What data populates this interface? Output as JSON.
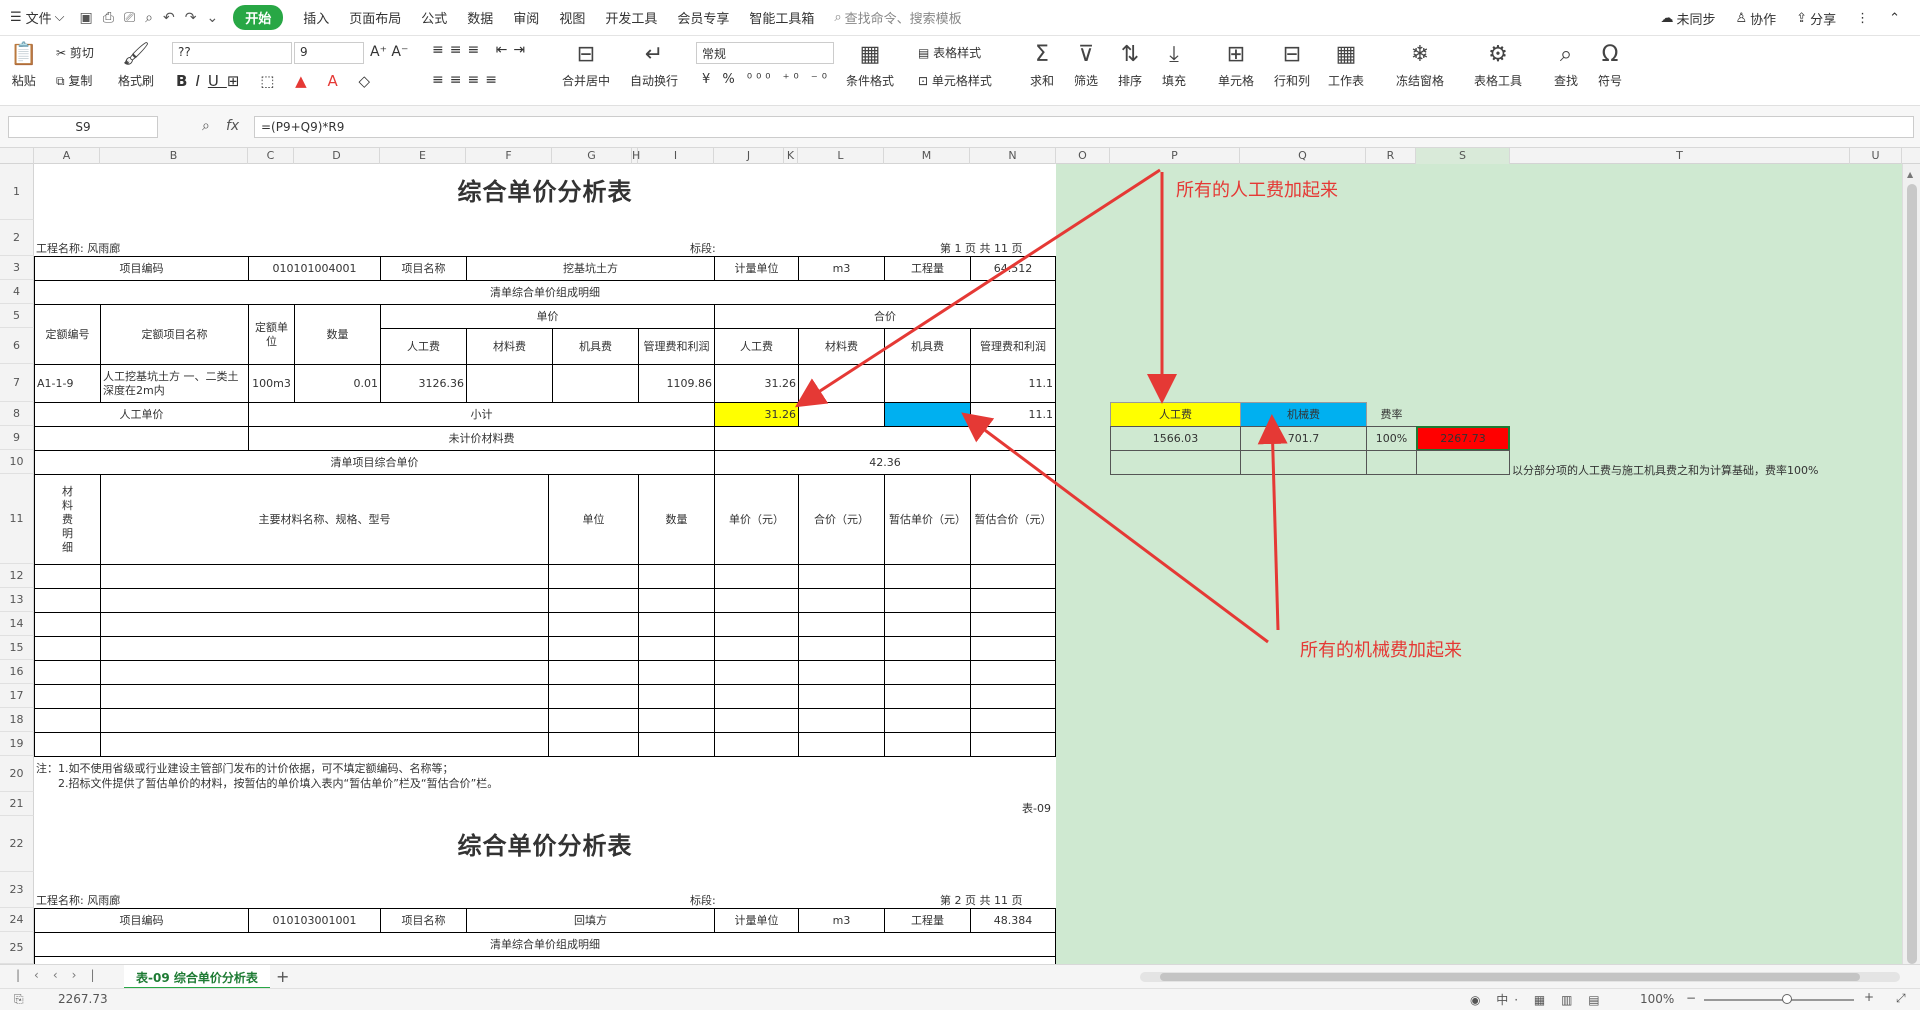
{
  "menu": {
    "file": "文件",
    "tabs": [
      "开始",
      "插入",
      "页面布局",
      "公式",
      "数据",
      "审阅",
      "视图",
      "开发工具",
      "会员专享",
      "智能工具箱"
    ],
    "search": "查找命令、搜索模板",
    "sync": "未同步",
    "collab": "协作",
    "share": "分享"
  },
  "ribbon": {
    "paste": "粘贴",
    "cut": "剪切",
    "copy": "复制",
    "format_painter": "格式刷",
    "font_name": "??",
    "font_size": "9",
    "number_format": "常规",
    "merge": "合并居中",
    "wrap": "自动换行",
    "cond_format": "条件格式",
    "table_style": "表格样式",
    "cell_style": "单元格样式",
    "sum": "求和",
    "filter": "筛选",
    "sort": "排序",
    "fill": "填充",
    "cell": "单元格",
    "rowcol": "行和列",
    "sheet": "工作表",
    "freeze": "冻结窗格",
    "table_tools": "表格工具",
    "find": "查找",
    "symbol": "符号"
  },
  "formula_bar": {
    "name_box": "S9",
    "fx": "fx",
    "formula": "=(P9+Q9)*R9"
  },
  "columns": [
    "A",
    "B",
    "C",
    "D",
    "E",
    "F",
    "G",
    "H",
    "I",
    "J",
    "K",
    "L",
    "M",
    "N",
    "O",
    "P",
    "Q",
    "R",
    "S",
    "T",
    "U"
  ],
  "rows": [
    "1",
    "2",
    "3",
    "4",
    "5",
    "6",
    "7",
    "8",
    "9",
    "10",
    "11",
    "12",
    "13",
    "14",
    "15",
    "16",
    "17",
    "18",
    "19",
    "20",
    "21",
    "22",
    "23",
    "24",
    "25"
  ],
  "sheet": {
    "title": "综合单价分析表",
    "project_label": "工程名称: 风雨廊",
    "section_label": "标段:",
    "page1": "第 1 页  共 11 页",
    "page2": "第 2 页  共 11 页",
    "r3": {
      "code_label": "项目编码",
      "code": "010101004001",
      "name_label": "项目名称",
      "name": "挖基坑土方",
      "unit_label": "计量单位",
      "unit": "m3",
      "qty_label": "工程量",
      "qty": "64.512"
    },
    "r4": "清单综合单价组成明细",
    "r5": {
      "c1": "定额编号",
      "c2": "定额项目名称",
      "c3": "定额单位",
      "c4": "数量",
      "unit_price": "单价",
      "total": "合价"
    },
    "r6": {
      "labor": "人工费",
      "material": "材料费",
      "machine": "机具费",
      "mgmt": "管理费和利润"
    },
    "r7": {
      "code": "A1-1-9",
      "name": "人工挖基坑土方 一、二类土 深度在2m内",
      "unit": "100m3",
      "qty": "0.01",
      "labor": "3126.36",
      "mgmt": "1109.86",
      "labor_t": "31.26",
      "mgmt_t": "11.1"
    },
    "r8": {
      "label": "人工单价",
      "subtotal": "小计",
      "labor": "31.26",
      "mgmt": "11.1"
    },
    "r9": "未计价材料费",
    "r10": {
      "label": "清单项目综合单价",
      "value": "42.36"
    },
    "r11": {
      "c1": "材料费明细",
      "c2": "主要材料名称、规格、型号",
      "c3": "单位",
      "c4": "数量",
      "c5": "单价（元）",
      "c6": "合价（元）",
      "c7": "暂估单价（元）",
      "c8": "暂估合价（元）"
    },
    "note1": "注：1.如不使用省级或行业建设主管部门发布的计价依据，可不填定额编码、名称等；",
    "note2": "2.招标文件提供了暂估单价的材料，按暂估的单价填入表内“暂估单价”栏及“暂估合价”栏。",
    "footer": "表-09",
    "r24": {
      "code_label": "项目编码",
      "code": "010103001001",
      "name_label": "项目名称",
      "name": "回填方",
      "unit_label": "计量单位",
      "unit": "m3",
      "qty_label": "工程量",
      "qty": "48.384"
    },
    "r25": "清单综合单价组成明细"
  },
  "side": {
    "labor_label": "人工费",
    "machine_label": "机械费",
    "rate_label": "费率",
    "labor": "1566.03",
    "machine": "701.7",
    "rate": "100%",
    "result": "2267.73",
    "note": "以分部分项的人工费与施工机具费之和为计算基础，费率100%"
  },
  "annotations": {
    "top": "所有的人工费加起来",
    "bottom": "所有的机械费加起来"
  },
  "tabs": {
    "sheet": "表-09 综合单价分析表"
  },
  "status": {
    "value": "2267.73",
    "zoom": "100%"
  },
  "colors": {
    "accent": "#28a745",
    "yellow": "#ffff00",
    "cyan": "#00b0f0",
    "red": "#ff0000",
    "green_bg": "#cfe9d1",
    "annotation": "#e53935"
  }
}
